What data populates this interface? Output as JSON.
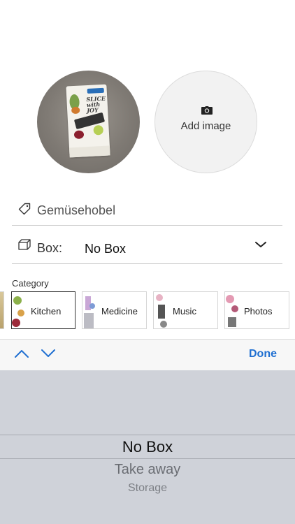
{
  "photos": {
    "add_image_label": "Add image"
  },
  "form": {
    "name_placeholder": "Gemüsehobel",
    "box_label": "Box:",
    "box_value": "No Box"
  },
  "categories": {
    "label": "Category",
    "items": [
      {
        "name": "Kitchen",
        "selected": true
      },
      {
        "name": "Medicine",
        "selected": false
      },
      {
        "name": "Music",
        "selected": false
      },
      {
        "name": "Photos",
        "selected": false
      }
    ]
  },
  "toolbar": {
    "done_label": "Done"
  },
  "picker": {
    "options": [
      "No Box",
      "Take away",
      "Storage"
    ],
    "selected": "No Box"
  },
  "colors": {
    "accent": "#1f6fd1",
    "picker_bg": "#cfd2d9"
  }
}
